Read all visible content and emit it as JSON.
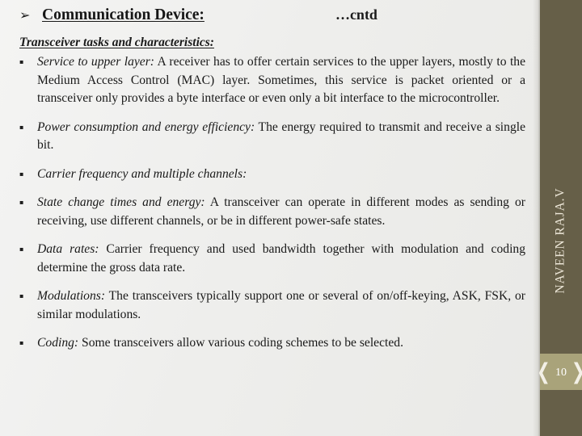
{
  "slide": {
    "title": {
      "arrow_icon": "➢",
      "heading": "Communication Device:",
      "continued_label": "…cntd"
    },
    "subtitle": "Transceiver tasks and characteristics:",
    "bullet_marker": "▪",
    "bullets": [
      {
        "lead": "Service to upper layer:",
        "rest": " A receiver has to offer certain services to the upper layers, mostly to the Medium Access Control (MAC) layer. Sometimes, this service is packet oriented or a transceiver only provides a byte interface or even only a bit interface to the microcontroller."
      },
      {
        "lead": "Power consumption and energy efficiency:",
        "rest": " The energy required to transmit and receive a single bit."
      },
      {
        "lead": "Carrier frequency and multiple channels:",
        "rest": ""
      },
      {
        "lead": "State change times and energy:",
        "rest": " A transceiver can operate in different modes as sending or receiving, use different channels, or be in different power-safe states."
      },
      {
        "lead": "Data rates:",
        "rest": " Carrier frequency and used bandwidth together with modulation and coding determine the gross data rate."
      },
      {
        "lead": "Modulations:",
        "rest": " The transceivers typically support one or several of on/off-keying, ASK, FSK, or similar modulations."
      },
      {
        "lead": "Coding:",
        "rest": " Some transceivers allow various coding schemes to be selected."
      }
    ]
  },
  "sidebar": {
    "author": "NAVEEN RAJA.V",
    "page_number": "10",
    "bracket_left": "❮",
    "bracket_right": "❯",
    "band_color": "#665F48",
    "badge_color": "#A9A37A",
    "author_text_color": "#ECE6D7"
  }
}
